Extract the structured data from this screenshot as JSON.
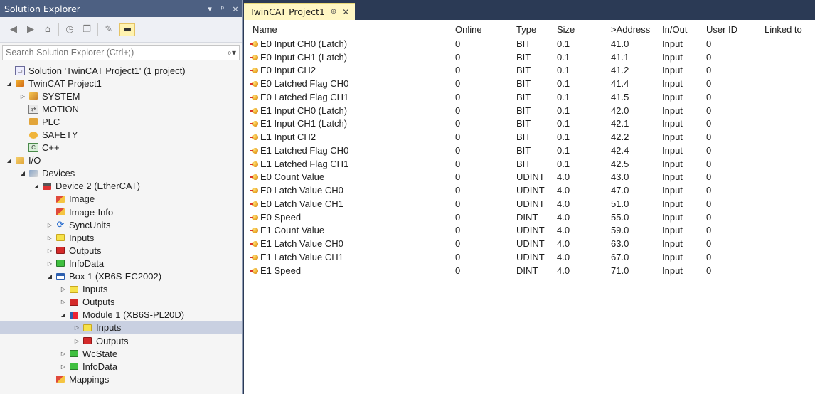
{
  "solution_explorer": {
    "title": "Solution Explorer",
    "title_buttons": [
      "▾",
      "ᵖ",
      "×"
    ],
    "search_placeholder": "Search Solution Explorer (Ctrl+;)",
    "tree": [
      {
        "label": "Solution 'TwinCAT Project1' (1 project)",
        "indent": 0,
        "exp": "",
        "icon": "solution-icon"
      },
      {
        "label": "TwinCAT Project1",
        "indent": 0,
        "exp": "◢",
        "icon": "project-icon"
      },
      {
        "label": "SYSTEM",
        "indent": 1,
        "exp": "▷",
        "icon": "system-icon"
      },
      {
        "label": "MOTION",
        "indent": 1,
        "exp": "",
        "icon": "motion-icon"
      },
      {
        "label": "PLC",
        "indent": 1,
        "exp": "",
        "icon": "plc-icon"
      },
      {
        "label": "SAFETY",
        "indent": 1,
        "exp": "",
        "icon": "safety-icon"
      },
      {
        "label": "C++",
        "indent": 1,
        "exp": "",
        "icon": "cpp-icon"
      },
      {
        "label": "I/O",
        "indent": 0,
        "exp": "◢",
        "icon": "io-icon"
      },
      {
        "label": "Devices",
        "indent": 1,
        "exp": "◢",
        "icon": "devices-icon"
      },
      {
        "label": "Device 2 (EtherCAT)",
        "indent": 2,
        "exp": "◢",
        "icon": "ethercat-device-icon"
      },
      {
        "label": "Image",
        "indent": 3,
        "exp": "",
        "icon": "image-icon"
      },
      {
        "label": "Image-Info",
        "indent": 3,
        "exp": "",
        "icon": "image-info-icon"
      },
      {
        "label": "SyncUnits",
        "indent": 3,
        "exp": "▷",
        "icon": "sync-units-icon"
      },
      {
        "label": "Inputs",
        "indent": 3,
        "exp": "▷",
        "icon": "inputs-folder-icon"
      },
      {
        "label": "Outputs",
        "indent": 3,
        "exp": "▷",
        "icon": "outputs-folder-icon"
      },
      {
        "label": "InfoData",
        "indent": 3,
        "exp": "▷",
        "icon": "infodata-folder-icon"
      },
      {
        "label": "Box 1 (XB6S-EC2002)",
        "indent": 3,
        "exp": "◢",
        "icon": "box-icon"
      },
      {
        "label": "Inputs",
        "indent": 4,
        "exp": "▷",
        "icon": "inputs-folder-icon"
      },
      {
        "label": "Outputs",
        "indent": 4,
        "exp": "▷",
        "icon": "outputs-folder-icon"
      },
      {
        "label": "Module 1 (XB6S-PL20D)",
        "indent": 4,
        "exp": "◢",
        "icon": "module-icon"
      },
      {
        "label": "Inputs",
        "indent": 5,
        "exp": "▷",
        "icon": "inputs-folder-icon",
        "selected": true
      },
      {
        "label": "Outputs",
        "indent": 5,
        "exp": "▷",
        "icon": "outputs-folder-icon"
      },
      {
        "label": "WcState",
        "indent": 4,
        "exp": "▷",
        "icon": "wcstate-folder-icon"
      },
      {
        "label": "InfoData",
        "indent": 4,
        "exp": "▷",
        "icon": "infodata-folder-icon"
      },
      {
        "label": "Mappings",
        "indent": 3,
        "exp": "",
        "icon": "mappings-icon"
      }
    ]
  },
  "editor": {
    "tab_title": "TwinCAT Project1",
    "tab_pin": "⊕",
    "tab_close": "✕",
    "columns": [
      "Name",
      "Online",
      "Type",
      "Size",
      ">Address",
      "In/Out",
      "User ID",
      "Linked to"
    ],
    "rows": [
      [
        "E0 Input CH0 (Latch)",
        "0",
        "BIT",
        "0.1",
        "41.0",
        "Input",
        "0",
        ""
      ],
      [
        "E0 Input CH1 (Latch)",
        "0",
        "BIT",
        "0.1",
        "41.1",
        "Input",
        "0",
        ""
      ],
      [
        "E0 Input CH2",
        "0",
        "BIT",
        "0.1",
        "41.2",
        "Input",
        "0",
        ""
      ],
      [
        "E0 Latched Flag CH0",
        "0",
        "BIT",
        "0.1",
        "41.4",
        "Input",
        "0",
        ""
      ],
      [
        "E0 Latched Flag CH1",
        "0",
        "BIT",
        "0.1",
        "41.5",
        "Input",
        "0",
        ""
      ],
      [
        "E1 Input CH0 (Latch)",
        "0",
        "BIT",
        "0.1",
        "42.0",
        "Input",
        "0",
        ""
      ],
      [
        "E1 Input CH1 (Latch)",
        "0",
        "BIT",
        "0.1",
        "42.1",
        "Input",
        "0",
        ""
      ],
      [
        "E1 Input CH2",
        "0",
        "BIT",
        "0.1",
        "42.2",
        "Input",
        "0",
        ""
      ],
      [
        "E1 Latched Flag CH0",
        "0",
        "BIT",
        "0.1",
        "42.4",
        "Input",
        "0",
        ""
      ],
      [
        "E1 Latched Flag CH1",
        "0",
        "BIT",
        "0.1",
        "42.5",
        "Input",
        "0",
        ""
      ],
      [
        "E0 Count Value",
        "0",
        "UDINT",
        "4.0",
        "43.0",
        "Input",
        "0",
        ""
      ],
      [
        "E0 Latch Value CH0",
        "0",
        "UDINT",
        "4.0",
        "47.0",
        "Input",
        "0",
        ""
      ],
      [
        "E0 Latch Value CH1",
        "0",
        "UDINT",
        "4.0",
        "51.0",
        "Input",
        "0",
        ""
      ],
      [
        "E0 Speed",
        "0",
        "DINT",
        "4.0",
        "55.0",
        "Input",
        "0",
        ""
      ],
      [
        "E1 Count Value",
        "0",
        "UDINT",
        "4.0",
        "59.0",
        "Input",
        "0",
        ""
      ],
      [
        "E1 Latch Value CH0",
        "0",
        "UDINT",
        "4.0",
        "63.0",
        "Input",
        "0",
        ""
      ],
      [
        "E1 Latch Value CH1",
        "0",
        "UDINT",
        "4.0",
        "67.0",
        "Input",
        "0",
        ""
      ],
      [
        "E1 Speed",
        "0",
        "DINT",
        "4.0",
        "71.0",
        "Input",
        "0",
        ""
      ]
    ]
  },
  "colors": {
    "title_bar": "#4d6082",
    "selection": "#c9d0e1",
    "tab_active": "#fff7c4",
    "frame": "#2b3a55"
  }
}
